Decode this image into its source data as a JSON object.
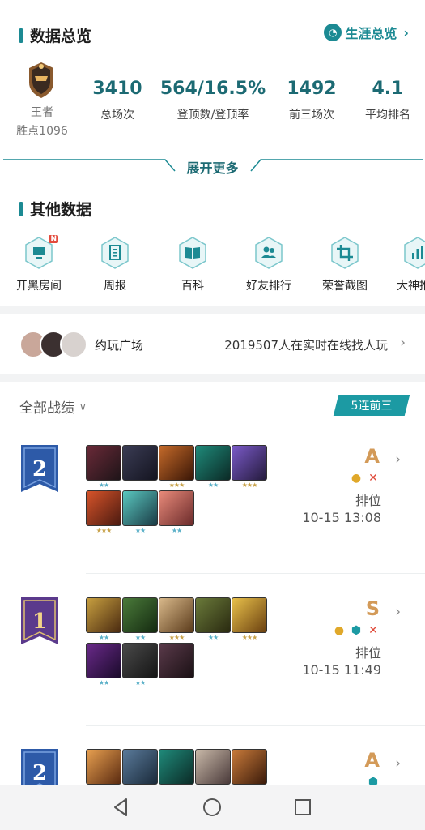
{
  "overview": {
    "title": "数据总览",
    "career_link": "生涯总览",
    "rank_name": "王者",
    "rank_points": "胜点1096",
    "stats": [
      {
        "value": "3410",
        "label": "总场次"
      },
      {
        "value": "564/16.5%",
        "label": "登顶数/登顶率"
      },
      {
        "value": "1492",
        "label": "前三场次"
      },
      {
        "value": "4.1",
        "label": "平均排名"
      }
    ],
    "expand_label": "展开更多"
  },
  "other_data": {
    "title": "其他数据",
    "tools": [
      {
        "label": "开黑房间",
        "icon": "room-icon",
        "badge": "N"
      },
      {
        "label": "周报",
        "icon": "report-icon"
      },
      {
        "label": "百科",
        "icon": "book-icon"
      },
      {
        "label": "好友排行",
        "icon": "friends-icon"
      },
      {
        "label": "荣誉截图",
        "icon": "crop-icon"
      },
      {
        "label": "大神推",
        "icon": "chart-icon"
      }
    ]
  },
  "plaza": {
    "label": "约玩广场",
    "online_text": "2019507人在实时在线找人玩"
  },
  "records": {
    "filter_label": "全部战绩",
    "streak_badge": "5连前三",
    "matches": [
      {
        "placement": "2",
        "grade": "A",
        "mode": "排位",
        "time": "10-15 13:08",
        "icons": [
          "coin-icon",
          "swords-icon"
        ]
      },
      {
        "placement": "1",
        "grade": "S",
        "mode": "排位",
        "time": "10-15 11:49",
        "icons": [
          "coin-icon",
          "hex-shield-icon",
          "swords-icon"
        ]
      },
      {
        "placement": "2",
        "grade": "A",
        "mode": "",
        "time": "",
        "icons": [
          "hex-shield-icon"
        ]
      }
    ]
  },
  "colors": {
    "accent": "#1c8a93",
    "grade": "#d39a58",
    "banner_blue": "#2d5aa8",
    "banner_purple": "#5b3a8c"
  }
}
